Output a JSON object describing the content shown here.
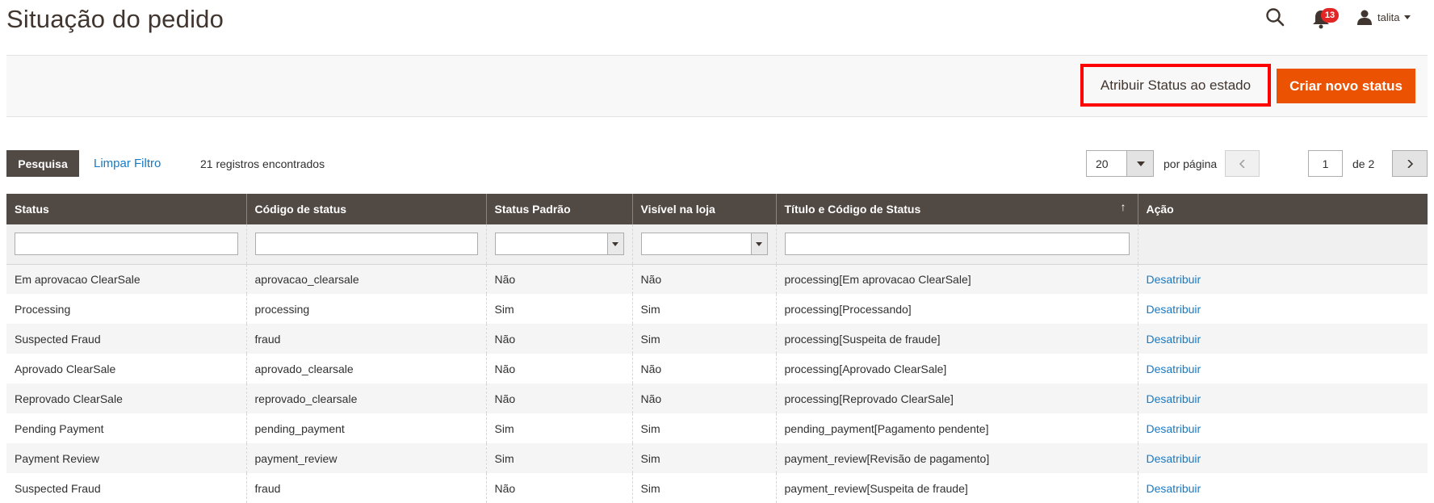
{
  "header": {
    "title": "Situação do pedido",
    "notification_count": "13",
    "user_name": "talita"
  },
  "actions": {
    "assign_label": "Atribuir Status ao estado",
    "create_label": "Criar novo status",
    "create_color": "#eb5202",
    "highlight_color": "#ff0000"
  },
  "toolbar": {
    "search_label": "Pesquisa",
    "clear_filter_label": "Limpar Filtro",
    "records_text": "21 registros encontrados",
    "per_page_value": "20",
    "per_page_label": "por página",
    "current_page": "1",
    "page_of_label": "de 2"
  },
  "table": {
    "columns": [
      "Status",
      "Código de status",
      "Status Padrão",
      "Visível na loja",
      "Título e Código de Status",
      "Ação"
    ],
    "sort_indicator": "↑",
    "rows": [
      {
        "status": "Em aprovacao ClearSale",
        "code": "aprovacao_clearsale",
        "default": "Não",
        "visible": "Não",
        "title": "processing[Em aprovacao ClearSale]",
        "action": "Desatribuir"
      },
      {
        "status": "Processing",
        "code": "processing",
        "default": "Sim",
        "visible": "Sim",
        "title": "processing[Processando]",
        "action": "Desatribuir"
      },
      {
        "status": "Suspected Fraud",
        "code": "fraud",
        "default": "Não",
        "visible": "Sim",
        "title": "processing[Suspeita de fraude]",
        "action": "Desatribuir"
      },
      {
        "status": "Aprovado ClearSale",
        "code": "aprovado_clearsale",
        "default": "Não",
        "visible": "Não",
        "title": "processing[Aprovado ClearSale]",
        "action": "Desatribuir"
      },
      {
        "status": "Reprovado ClearSale",
        "code": "reprovado_clearsale",
        "default": "Não",
        "visible": "Não",
        "title": "processing[Reprovado ClearSale]",
        "action": "Desatribuir"
      },
      {
        "status": "Pending Payment",
        "code": "pending_payment",
        "default": "Sim",
        "visible": "Sim",
        "title": "pending_payment[Pagamento pendente]",
        "action": "Desatribuir"
      },
      {
        "status": "Payment Review",
        "code": "payment_review",
        "default": "Sim",
        "visible": "Sim",
        "title": "payment_review[Revisão de pagamento]",
        "action": "Desatribuir"
      },
      {
        "status": "Suspected Fraud",
        "code": "fraud",
        "default": "Não",
        "visible": "Sim",
        "title": "payment_review[Suspeita de fraude]",
        "action": "Desatribuir"
      }
    ]
  }
}
